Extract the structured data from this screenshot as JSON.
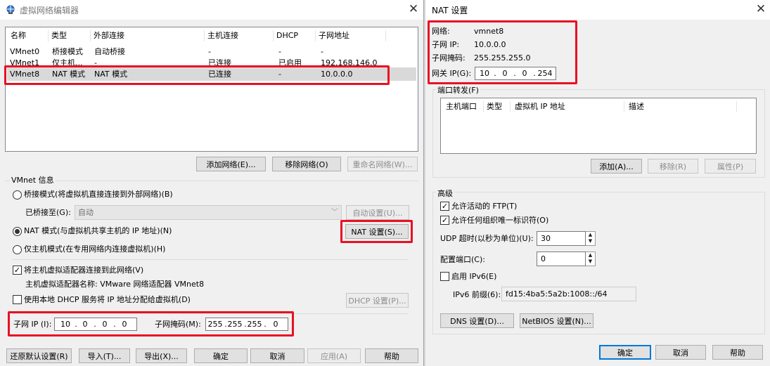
{
  "left": {
    "title": "虚拟网络编辑器",
    "columns": [
      "名称",
      "类型",
      "外部连接",
      "主机连接",
      "DHCP",
      "子网地址"
    ],
    "rows": [
      {
        "name": "VMnet0",
        "type": "桥接模式",
        "ext": "自动桥接",
        "host": "-",
        "dhcp": "-",
        "subnet": "-"
      },
      {
        "name": "VMnet1",
        "type": "仅主机...",
        "ext": "-",
        "host": "已连接",
        "dhcp": "已启用",
        "subnet": "192.168.146.0"
      },
      {
        "name": "VMnet8",
        "type": "NAT 模式",
        "ext": "NAT 模式",
        "host": "已连接",
        "dhcp": "-",
        "subnet": "10.0.0.0"
      }
    ],
    "btn_add": "添加网络(E)...",
    "btn_remove": "移除网络(O)",
    "btn_rename": "重命名网络(W)...",
    "vmnet_info": "VMnet 信息",
    "radio_bridge": "桥接模式(将虚拟机直接连接到外部网络)(B)",
    "bridged_to_label": "已桥接至(G):",
    "bridged_to_value": "自动",
    "btn_auto_settings": "自动设置(U)...",
    "radio_nat": "NAT 模式(与虚拟机共享主机的 IP 地址)(N)",
    "btn_nat_settings": "NAT 设置(S)...",
    "radio_hostonly": "仅主机模式(在专用网络内连接虚拟机)(H)",
    "check_connect_adapter": "将主机虚拟适配器连接到此网络(V)",
    "adapter_name": "主机虚拟适配器名称: VMware 网络适配器 VMnet8",
    "check_dhcp": "使用本地 DHCP 服务将 IP 地址分配给虚拟机(D)",
    "btn_dhcp_settings": "DHCP 设置(P)...",
    "subnet_ip_label": "子网 IP (I):",
    "subnet_ip": [
      "10",
      "0",
      "0",
      "0"
    ],
    "mask_label": "子网掩码(M):",
    "mask": [
      "255",
      "255",
      "255",
      "0"
    ],
    "btn_restore": "还原默认设置(R)",
    "btn_import": "导入(T)...",
    "btn_export": "导出(X)...",
    "btn_ok": "确定",
    "btn_cancel": "取消",
    "btn_apply": "应用(A)",
    "btn_help": "帮助"
  },
  "right": {
    "title": "NAT 设置",
    "network_label": "网络:",
    "network_value": "vmnet8",
    "subnet_ip_label": "子网 IP:",
    "subnet_ip_value": "10.0.0.0",
    "mask_label": "子网掩码:",
    "mask_value": "255.255.255.0",
    "gateway_label": "网关 IP(G):",
    "gateway": [
      "10",
      "0",
      "0",
      "254"
    ],
    "port_forward": "端口转发(F)",
    "pf_columns": [
      "主机端口",
      "类型",
      "虚拟机 IP 地址",
      "描述"
    ],
    "btn_add": "添加(A)...",
    "btn_remove": "移除(R)",
    "btn_props": "属性(P)",
    "advanced": "高级",
    "check_ftp": "允许活动的 FTP(T)",
    "check_oui": "允许任何组织唯一标识符(O)",
    "udp_label": "UDP 超时(以秒为单位)(U):",
    "udp_value": "30",
    "config_port_label": "配置端口(C):",
    "config_port_value": "0",
    "check_ipv6": "启用 IPv6(E)",
    "ipv6_prefix_label": "IPv6 前缀(6):",
    "ipv6_prefix_value": "fd15:4ba5:5a2b:1008::/64",
    "btn_dns": "DNS 设置(D)...",
    "btn_netbios": "NetBIOS 设置(N)...",
    "btn_ok": "确定",
    "btn_cancel": "取消",
    "btn_help": "帮助"
  },
  "colors": {
    "highlight": "#e81123",
    "accent": "#0078d7"
  }
}
